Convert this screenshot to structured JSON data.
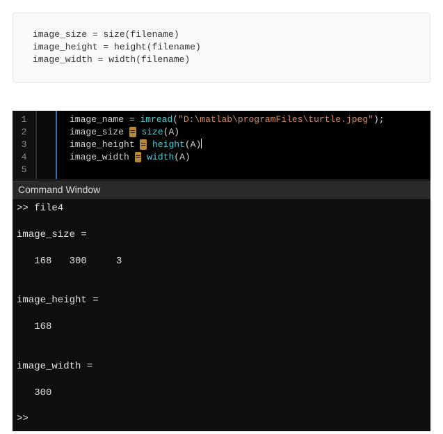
{
  "doc_code": {
    "line1": "image_size = size(filename)",
    "line2": "image_height = height(filename)",
    "line3": "image_width = width(filename)"
  },
  "editor": {
    "gutter": [
      "1",
      "2",
      "3",
      "4",
      "5"
    ],
    "line1": {
      "var": "image_name ",
      "assign": "=",
      "sp": " ",
      "fn": "imread",
      "open": "(",
      "str": "\"D:\\matlab\\programFiles\\turtle.jpeg\"",
      "close": ");"
    },
    "line2": {
      "var": "image_size ",
      "assign": "=",
      "sp": " ",
      "fn": "size",
      "args": "(A)"
    },
    "line3": {
      "var": "image_height ",
      "assign": "=",
      "sp": " ",
      "fn": "height",
      "args": "(A)"
    },
    "line4": {
      "var": "image_width ",
      "assign": "=",
      "sp": " ",
      "fn": "width",
      "args": "(A)"
    }
  },
  "cmd": {
    "header": "Command Window",
    "body": ">> file4\n\nimage_size =\n\n   168   300     3\n\n\nimage_height =\n\n   168\n\n\nimage_width =\n\n   300\n\n>> "
  }
}
